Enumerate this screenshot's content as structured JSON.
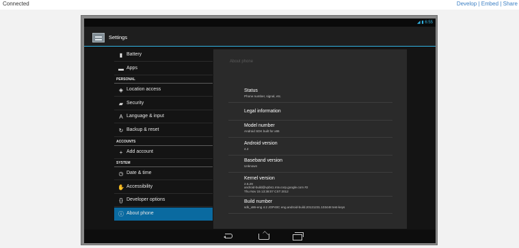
{
  "topbar": {
    "status": "Connected",
    "links": [
      "Develop",
      "Embed",
      "Share"
    ],
    "sep": "|"
  },
  "statusbar": {
    "time": "6:55"
  },
  "actionbar": {
    "title": "Settings"
  },
  "left_list": [
    {
      "kind": "item",
      "label": "Battery",
      "icon": "battery-icon",
      "glyph": "▮"
    },
    {
      "kind": "item",
      "label": "Apps",
      "icon": "apps-icon",
      "glyph": "▬"
    },
    {
      "kind": "header",
      "label": "PERSONAL"
    },
    {
      "kind": "item",
      "label": "Location access",
      "icon": "location-icon",
      "glyph": "◈"
    },
    {
      "kind": "item",
      "label": "Security",
      "icon": "lock-icon",
      "glyph": "▰"
    },
    {
      "kind": "item",
      "label": "Language & input",
      "icon": "language-icon",
      "glyph": "A"
    },
    {
      "kind": "item",
      "label": "Backup & reset",
      "icon": "backup-icon",
      "glyph": "↻"
    },
    {
      "kind": "header",
      "label": "ACCOUNTS"
    },
    {
      "kind": "item",
      "label": "Add account",
      "icon": "plus-icon",
      "glyph": "+"
    },
    {
      "kind": "header",
      "label": "SYSTEM"
    },
    {
      "kind": "item",
      "label": "Date & time",
      "icon": "clock-icon",
      "glyph": "◷"
    },
    {
      "kind": "item",
      "label": "Accessibility",
      "icon": "accessibility-icon",
      "glyph": "✋"
    },
    {
      "kind": "item",
      "label": "Developer options",
      "icon": "code-icon",
      "glyph": "{}"
    },
    {
      "kind": "item",
      "label": "About phone",
      "icon": "info-icon",
      "glyph": "ⓘ",
      "selected": true
    }
  ],
  "detail": {
    "section_title": "About phone",
    "rows": [
      {
        "title": "Status",
        "summary": [
          "Phone number, signal, etc."
        ]
      },
      {
        "title": "Legal information",
        "summary": []
      },
      {
        "title": "Model number",
        "summary": [
          "Android SDK built for x86"
        ]
      },
      {
        "title": "Android version",
        "summary": [
          "4.2"
        ]
      },
      {
        "title": "Baseband version",
        "summary": [
          "Unknown"
        ]
      },
      {
        "title": "Kernel version",
        "summary": [
          "2.6.29",
          "android-build@vpbs1.mtv.corp.google.com #2",
          "Thu Nov 15 13:38:07 CST 2012"
        ]
      },
      {
        "title": "Build number",
        "summary": [
          "sdk_x86-eng 4.2 JOP40C eng.android-build.20121231.103448 test-keys"
        ]
      }
    ]
  },
  "colors": {
    "accent": "#33b5e5",
    "selected": "#0a6aa0",
    "link": "#3b7fc4"
  }
}
